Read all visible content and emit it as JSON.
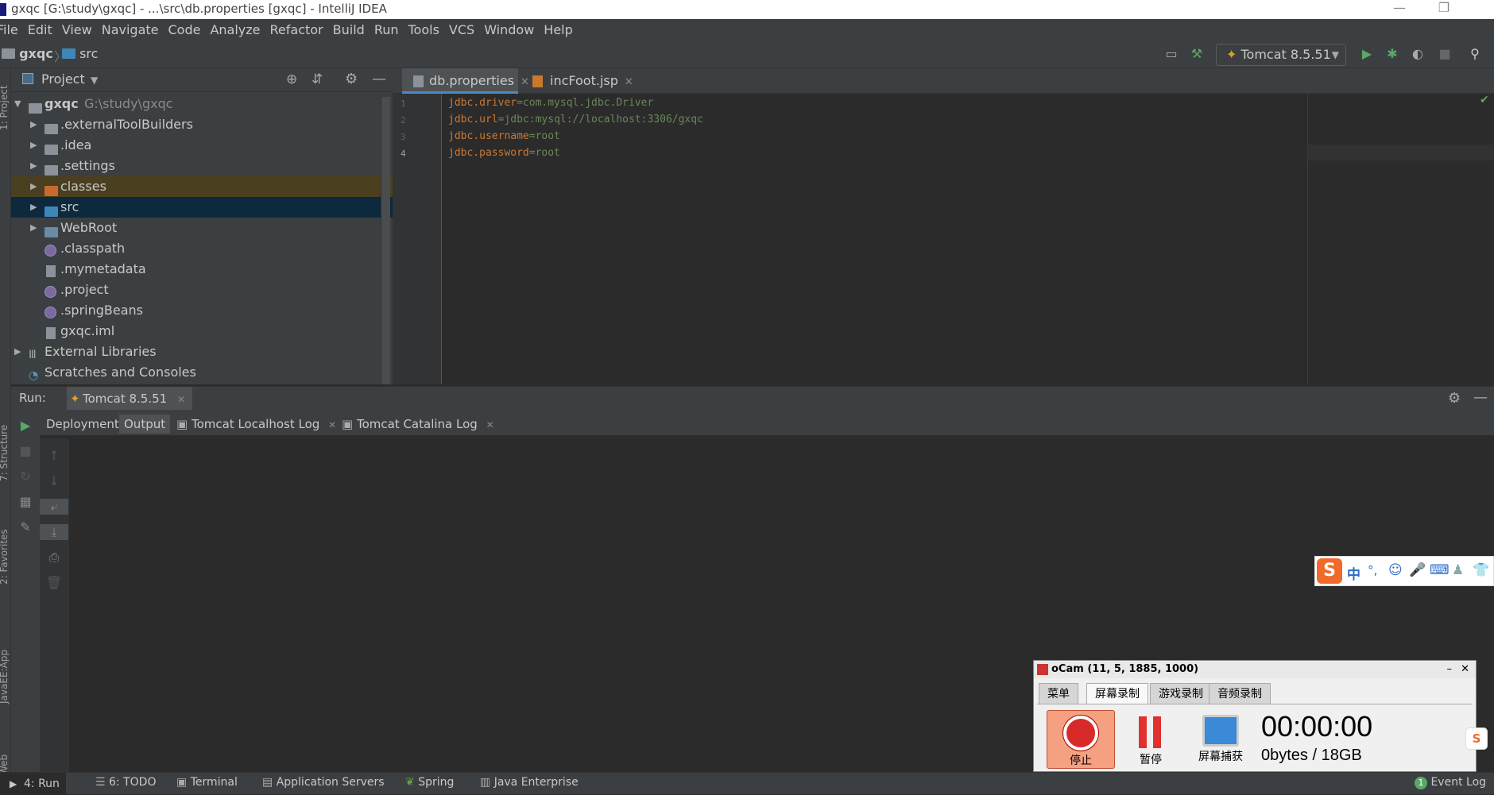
{
  "window": {
    "title": "gxqc [G:\\study\\gxqc] - ...\\src\\db.properties [gxqc] - IntelliJ IDEA"
  },
  "menu": [
    "File",
    "Edit",
    "View",
    "Navigate",
    "Code",
    "Analyze",
    "Refactor",
    "Build",
    "Run",
    "Tools",
    "VCS",
    "Window",
    "Help"
  ],
  "breadcrumb": {
    "project": "gxqc",
    "folder": "src"
  },
  "toolbar": {
    "run_config": "Tomcat 8.5.51"
  },
  "project_panel": {
    "title": "Project",
    "root": {
      "name": "gxqc",
      "path": "G:\\study\\gxqc"
    },
    "items": [
      {
        "label": ".externalToolBuilders",
        "type": "folder"
      },
      {
        "label": ".idea",
        "type": "folder"
      },
      {
        "label": ".settings",
        "type": "folder"
      },
      {
        "label": "classes",
        "type": "folder-excluded"
      },
      {
        "label": "src",
        "type": "folder-source"
      },
      {
        "label": "WebRoot",
        "type": "folder-web"
      },
      {
        "label": ".classpath",
        "type": "file"
      },
      {
        "label": ".mymetadata",
        "type": "file"
      },
      {
        "label": ".project",
        "type": "file"
      },
      {
        "label": ".springBeans",
        "type": "file"
      },
      {
        "label": "gxqc.iml",
        "type": "file"
      }
    ],
    "external": "External Libraries",
    "scratches": "Scratches and Consoles"
  },
  "left_strip": {
    "project": "1: Project",
    "structure": "7: Structure",
    "favorites": "2: Favorites",
    "javaee": "JavaEE:App",
    "web": "Web"
  },
  "editor": {
    "tabs": [
      {
        "label": "db.properties",
        "active": true
      },
      {
        "label": "incFoot.jsp",
        "active": false
      }
    ],
    "lines": [
      {
        "num": "1",
        "key": "jdbc.driver",
        "value": "com.mysql.jdbc.Driver"
      },
      {
        "num": "2",
        "key": "jdbc.url",
        "value": "jdbc:mysql://localhost:3306/gxqc"
      },
      {
        "num": "3",
        "key": "jdbc.username",
        "value": "root"
      },
      {
        "num": "4",
        "key": "jdbc.password",
        "value": "root"
      }
    ]
  },
  "run_panel": {
    "label": "Run:",
    "config": "Tomcat 8.5.51",
    "tabs": [
      "Deployment",
      "Output",
      "Tomcat Localhost Log",
      "Tomcat Catalina Log"
    ]
  },
  "statusbar": {
    "items": [
      "4: Run",
      "6: TODO",
      "Terminal",
      "Application Servers",
      "Spring",
      "Java Enterprise"
    ],
    "event_log": "Event Log",
    "event_count": "1"
  },
  "ime": {
    "lang": "中",
    "punct": "°,"
  },
  "ocam": {
    "title": "oCam (11, 5, 1885, 1000)",
    "tabs": [
      "菜单",
      "屏幕录制",
      "游戏录制",
      "音频录制"
    ],
    "buttons": [
      "停止",
      "暂停",
      "屏幕捕获"
    ],
    "time": "00:00:00",
    "size": "0bytes / 18GB"
  },
  "colors": {
    "accent": "#4a88c7",
    "keyword": "#cc7832",
    "string": "#6a8759",
    "selection": "#0d293e",
    "excluded": "#4a3f1f"
  }
}
